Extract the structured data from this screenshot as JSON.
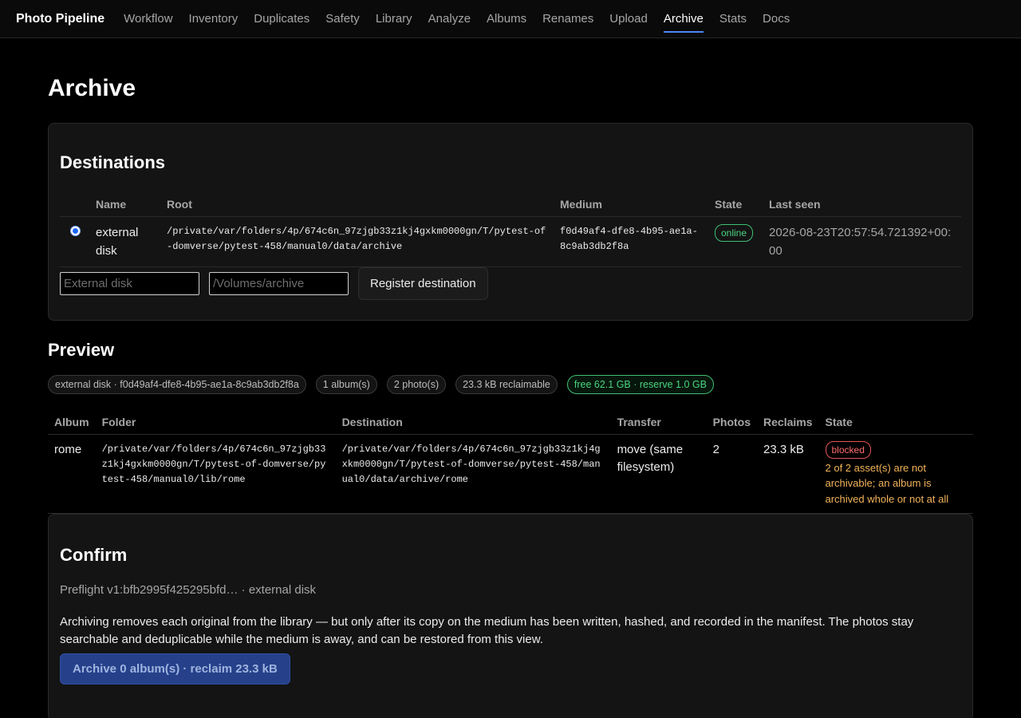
{
  "nav": {
    "brand": "Photo Pipeline",
    "links": [
      "Workflow",
      "Inventory",
      "Duplicates",
      "Safety",
      "Library",
      "Analyze",
      "Albums",
      "Renames",
      "Upload",
      "Archive",
      "Stats",
      "Docs"
    ],
    "active": "Archive"
  },
  "page": {
    "title": "Archive"
  },
  "destinations": {
    "title": "Destinations",
    "columns": [
      "",
      "Name",
      "Root",
      "Medium",
      "State",
      "Last seen"
    ],
    "rows": [
      {
        "selected": true,
        "name": "external disk",
        "root": "/private/var/folders/4p/674c6n_97zjgb33z1kj4gxkm0000gn/T/pytest-of-domverse/pytest-458/manual0/data/archive",
        "medium": "f0d49af4-dfe8-4b95-ae1a-8c9ab3db2f8a",
        "state": "online",
        "last_seen": "2026-08-23T20:57:54.721392+00:00"
      }
    ],
    "form": {
      "name_placeholder": "External disk",
      "root_placeholder": "/Volumes/archive",
      "register_label": "Register destination"
    }
  },
  "preview": {
    "title": "Preview",
    "chips": [
      "external disk · f0d49af4-dfe8-4b95-ae1a-8c9ab3db2f8a",
      "1 album(s)",
      "2 photo(s)",
      "23.3 kB reclaimable",
      "free 62.1 GB · reserve 1.0 GB"
    ],
    "columns": [
      "Album",
      "Folder",
      "Destination",
      "Transfer",
      "Photos",
      "Reclaims",
      "State"
    ],
    "rows": [
      {
        "album": "rome",
        "folder": "/private/var/folders/4p/674c6n_97zjgb33z1kj4gxkm0000gn/T/pytest-of-domverse/pytest-458/manual0/lib/rome",
        "destination": "/private/var/folders/4p/674c6n_97zjgb33z1kj4gxkm0000gn/T/pytest-of-domverse/pytest-458/manual0/data/archive/rome",
        "transfer": "move (same filesystem)",
        "photos": "2",
        "reclaims": "23.3 kB",
        "state": "blocked",
        "reason": "2 of 2 asset(s) are not archivable; an album is archived whole or not at all"
      }
    ]
  },
  "confirm": {
    "title": "Confirm",
    "preflight": "Preflight v1:bfb2995f425295bfd… · external disk",
    "explain": "Archiving removes each original from the library — but only after its copy on the medium has been written, hashed, and recorded in the manifest. The photos stay searchable and deduplicable while the medium is away, and can be restored from this view.",
    "button_label": "Archive 0 album(s) · reclaim 23.3 kB"
  },
  "colors": {
    "accent": "#4f86f7",
    "online": "#4ad47f",
    "blocked": "#ff6b6b",
    "warning": "#f2b35a",
    "primary_button": "#26418a"
  }
}
